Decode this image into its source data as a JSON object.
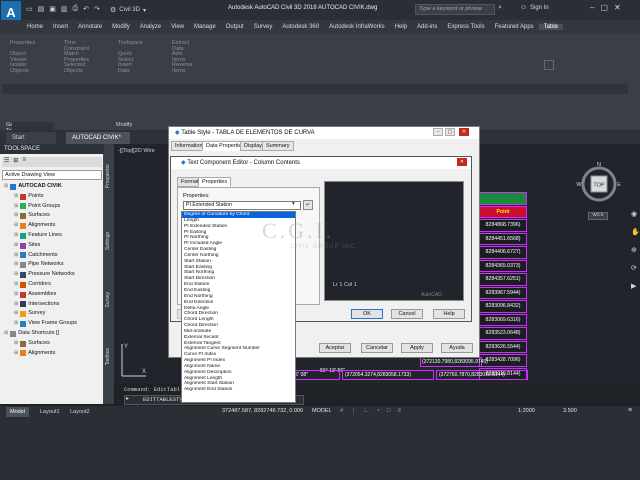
{
  "titlebar": {
    "logo": "A",
    "logo_sub": "CIV",
    "workspace": "Civil 3D",
    "title": "Autodesk AutoCAD Civil 3D 2018    AUTOCAD CIVIK.dwg",
    "search_placeholder": "Type a keyword or phrase",
    "signin": "Sign In"
  },
  "menu": {
    "tabs": [
      "Home",
      "Insert",
      "Annotate",
      "Modify",
      "Analyze",
      "View",
      "Manage",
      "Output",
      "Survey",
      "Autodesk 360",
      "Autodesk InfraWorks",
      "Help",
      "Add-ins",
      "Express Tools",
      "Featured Apps",
      "Table"
    ]
  },
  "ribbon": {
    "tools": [
      "Properties",
      "Object Viewer",
      "Isolate Objects",
      "Time Constraint",
      "Match Properties",
      "Selected Objects",
      "Toolspace",
      "Quick Select",
      "Insert Data",
      "Extract Data",
      "Add Items",
      "Reverse Items"
    ],
    "panels": [
      "General Tools",
      "Modify"
    ]
  },
  "doctabs": [
    "Start",
    "AUTOCAD CIVIK*"
  ],
  "toolspace": {
    "title": "TOOLSPACE",
    "view": "Active Drawing View",
    "tree": [
      "AUTOCAD CIVIK",
      "Points",
      "Point Groups",
      "Surfaces",
      "Alignments",
      "Feature Lines",
      "Sites",
      "Catchments",
      "Pipe Networks",
      "Pressure Networks",
      "Corridors",
      "Assemblies",
      "Intersections",
      "Survey",
      "View Frame Groups",
      "Data Shortcuts []",
      "Surfaces",
      "Alignments"
    ],
    "side_tabs": [
      "Prospector",
      "Settings",
      "Survey",
      "Toolbox"
    ]
  },
  "canvas": {
    "view_label": "-][Top][2D Wire",
    "point_table": {
      "header": "Point",
      "rows": [
        "8284868.7396)",
        "8284451.6568)",
        "8284406.6727)",
        "8284365.0373)",
        "8284357.6251)",
        "8283967.5944)",
        "8283096.8432)",
        "8283069.6316)",
        "8283523.0648)",
        "8283626.5544)",
        "8283428.7096)",
        "8283010.8144)"
      ]
    },
    "coord_rows": [
      "(372130.7980,8283095.9740)",
      "(372054.3274,8283058.1733)",
      "(372760.7870,8283010.8144)"
    ],
    "angle_rows": [
      "56° 18' 56\"",
      "63° 36' 08\""
    ],
    "navcube": "TOP",
    "wcs": "WCS"
  },
  "table_style": {
    "title": "Table Style - TABLA DE ELEMENTOS DE CURVA",
    "tabs": [
      "Information",
      "Data Properties",
      "Display",
      "Summary"
    ],
    "buttons": [
      "Aceptar",
      "Cancelar",
      "Apply",
      "Ayuda"
    ]
  },
  "tce": {
    "title": "Text Component Editor - Column Contents",
    "tabs": [
      "Format",
      "Properties"
    ],
    "properties_label": "Properties:",
    "selected": "PI Extended Station",
    "preview_cell": "Lr 1 Col 1",
    "preview_brand": "AutoCAD",
    "buttons": [
      "OK",
      "Cancel",
      "Help"
    ]
  },
  "dropdown": {
    "selected_index": 0,
    "items": [
      "Degree of Curvature by Chord",
      "Length",
      "PI Extended Station",
      "PI Easting",
      "PI Northing",
      "PI Included Angle",
      "Center Easting",
      "Center Northing",
      "Start Station",
      "Start Easting",
      "Start Northing",
      "Start Direction",
      "End Station",
      "End Easting",
      "End Northing",
      "End Direction",
      "Delta Angle",
      "Chord Direction",
      "Chord Length",
      "Chord Direction",
      "Mid-ordinate",
      "External Secant",
      "External Tangent",
      "Alignment Curve Segment Number",
      "Curve PI Index",
      "Alignment PI Index",
      "Alignment Name",
      "Alignment Description",
      "Alignment Length",
      "Alignment Start Station",
      "Alignment End Station"
    ]
  },
  "watermark": {
    "brand": "C.G.I.",
    "subtitle": "CIVIL GROUP INC."
  },
  "command": {
    "line1": "Command: EditTabl",
    "line2": "EDITTABLESTY"
  },
  "statusbar": {
    "tabs": [
      "Model",
      "Layout1",
      "Layout2"
    ],
    "coords": "372487.587, 8282746.732, 0.000",
    "mode": "MODEL",
    "scale": "1:2000",
    "zoom": "3.500"
  }
}
